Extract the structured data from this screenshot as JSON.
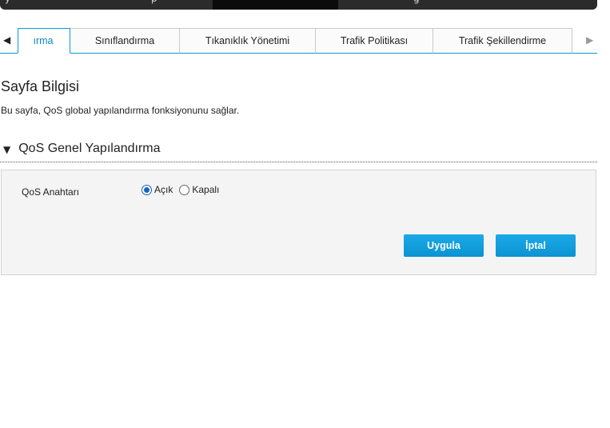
{
  "top_menu": {
    "items": [
      {
        "label": "y"
      },
      {
        "label": "p"
      },
      {
        "label": "g"
      }
    ]
  },
  "tabs": [
    {
      "label": "ırma",
      "active": true
    },
    {
      "label": "Sınıflandırma",
      "active": false
    },
    {
      "label": "Tıkanıklık Yönetimi",
      "active": false
    },
    {
      "label": "Trafik Politikası",
      "active": false
    },
    {
      "label": "Trafik Şekillendirme",
      "active": false
    }
  ],
  "tab_nav": {
    "left_icon": "triangle-left-icon",
    "right_icon": "triangle-right-icon"
  },
  "page_info": {
    "title": "Sayfa Bilgisi",
    "description": "Bu sayfa, QoS global yapılandırma fonksiyonunu sağlar."
  },
  "section": {
    "icon": "collapse-triangle-icon",
    "title": "QoS Genel Yapılandırma"
  },
  "form": {
    "qos_switch": {
      "label": "QoS Anahtarı",
      "options": [
        {
          "label": "Açık",
          "checked": true
        },
        {
          "label": "Kapalı",
          "checked": false
        }
      ]
    },
    "apply_label": "Uygula",
    "cancel_label": "İptal"
  },
  "colors": {
    "accent": "#0a9ad6",
    "button": "#1ba9e6",
    "panel_bg": "#f4f4f4",
    "radio_checked": "#1565c0"
  }
}
